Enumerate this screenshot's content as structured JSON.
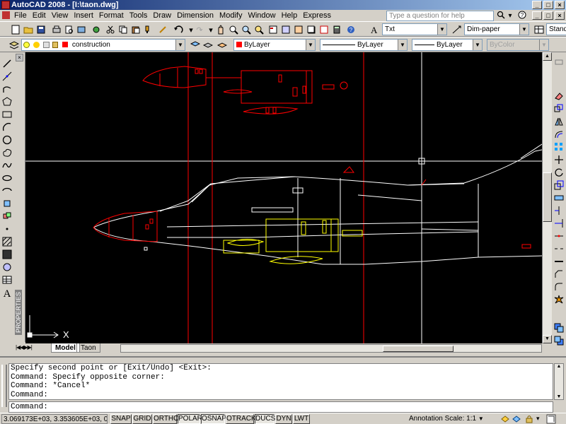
{
  "window": {
    "title": "AutoCAD 2008 - [I:\\taon.dwg]",
    "controls": [
      "_",
      "□",
      "×"
    ]
  },
  "menu": {
    "items": [
      "File",
      "Edit",
      "View",
      "Insert",
      "Format",
      "Tools",
      "Draw",
      "Dimension",
      "Modify",
      "Window",
      "Help",
      "Express"
    ],
    "help_placeholder": "Type a question for help",
    "doc_controls": [
      "_",
      "□",
      "×"
    ]
  },
  "toolbar": {
    "text_style": "Txt",
    "dim_style": "Dim-paper",
    "table_style": "Stand",
    "layer": "construction",
    "color": "ByLayer",
    "linetype": "ByLayer",
    "lineweight": "ByLayer",
    "plotstyle": "ByColor"
  },
  "drawing": {
    "ucs_x_label": "X",
    "colors": {
      "background": "#000000",
      "white": "#ffffff",
      "red": "#ff0000",
      "yellow": "#ffff00"
    }
  },
  "sidebar": {
    "properties_label": "PROPERTIES"
  },
  "layout_tabs": [
    "Model",
    "Taon"
  ],
  "command_line": {
    "history": [
      "Specify second point or [Exit/Undo] <Exit>:",
      "Command: Specify opposite corner:",
      "Command: *Cancel*",
      "Command:"
    ],
    "prompt": "Command:"
  },
  "status": {
    "coords": "3.069173E+03, 3.353605E+03, 0'-0\"",
    "toggles": [
      "SNAP",
      "GRID",
      "ORTHO",
      "POLAR",
      "OSNAP",
      "OTRACK",
      "DUCS",
      "DYN",
      "LWT"
    ],
    "annotation_scale_label": "Annotation Scale:",
    "annotation_scale_value": "1:1"
  }
}
